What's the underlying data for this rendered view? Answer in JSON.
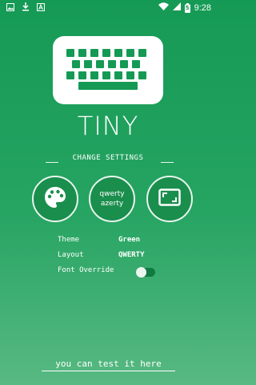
{
  "status_bar": {
    "time": "9:28",
    "icons": [
      "image-icon",
      "download-icon",
      "a-icon",
      "wifi-icon",
      "signal-icon",
      "battery-icon"
    ],
    "battery_badge": "5"
  },
  "app": {
    "title": "TINY"
  },
  "section": {
    "title": "CHANGE SETTINGS"
  },
  "buttons": {
    "theme_icon": "palette-icon",
    "layout_line1": "qwerty",
    "layout_line2": "azerty",
    "font_icon": "aspect-ratio-icon"
  },
  "settings": {
    "theme_label": "Theme",
    "theme_value": "Green",
    "layout_label": "Layout",
    "layout_value": "QWERTY",
    "font_override_label": "Font Override",
    "font_override_on": false
  },
  "test_input": {
    "placeholder": "you can test it here",
    "value": ""
  },
  "colors": {
    "accent": "#159a55",
    "background_top": "#159a55",
    "background_bottom": "#58b982",
    "button_fill": "#1a8e4d",
    "text": "#ffffff"
  }
}
